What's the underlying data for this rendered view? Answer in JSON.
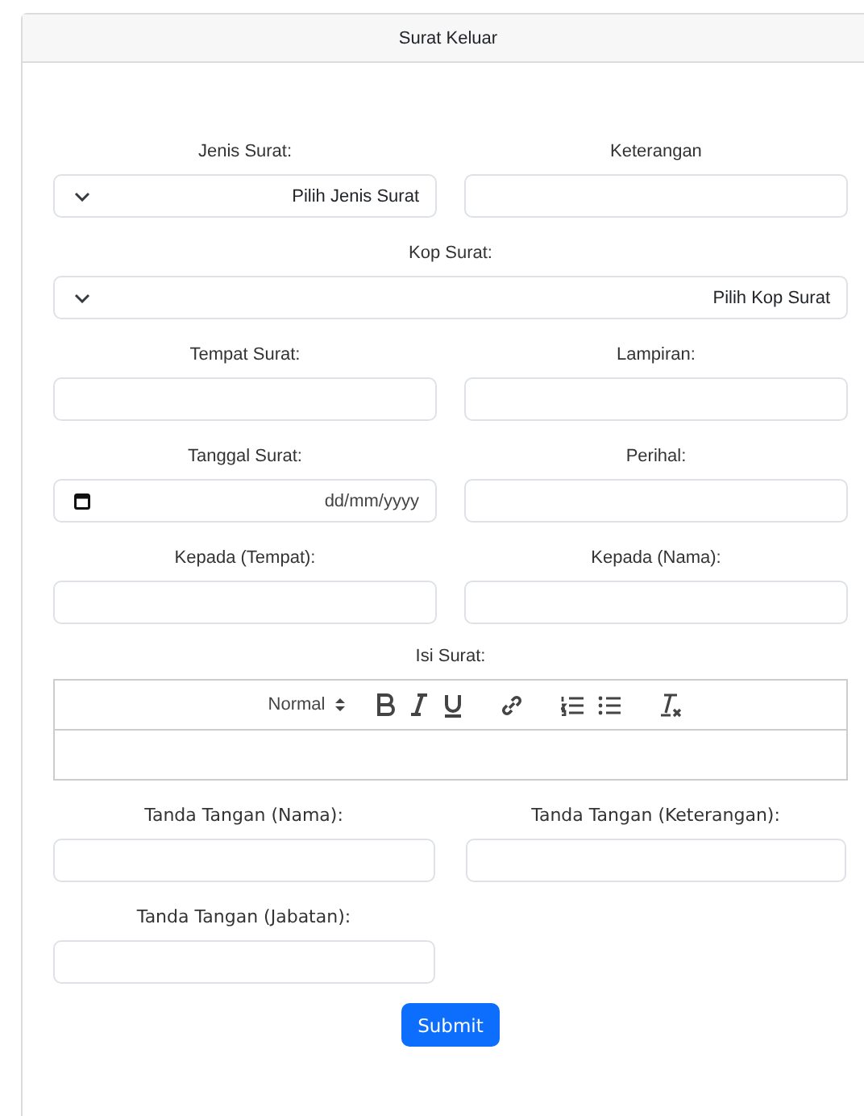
{
  "card": {
    "title": "Surat Keluar"
  },
  "rows": [
    [
      {
        "label": "Jenis Surat:",
        "kind": "select",
        "value": "Pilih Jenis Surat"
      },
      {
        "label": "Keterangan",
        "kind": "text"
      }
    ],
    [
      {
        "label": "Kop Surat:",
        "kind": "select",
        "value": "Pilih Kop Surat"
      }
    ],
    [
      {
        "label": "Tempat Surat:",
        "kind": "text"
      },
      {
        "label": "Lampiran:",
        "kind": "text"
      }
    ],
    [
      {
        "label": "Tanggal Surat:",
        "kind": "date",
        "placeholder": "dd/mm/yyyy"
      },
      {
        "label": "Perihal:",
        "kind": "text"
      }
    ],
    [
      {
        "label": "Kepada (Tempat):",
        "kind": "text"
      },
      {
        "label": "Kepada (Nama):",
        "kind": "text"
      }
    ]
  ],
  "editor": {
    "label": "Isi Surat:",
    "format": "Normal",
    "tools": [
      {
        "kind": "bold"
      },
      {
        "kind": "italic"
      },
      {
        "kind": "underline"
      },
      {
        "kind": "link"
      },
      {
        "kind": "ordered-list"
      },
      {
        "kind": "bullet-list"
      },
      {
        "kind": "clean"
      }
    ]
  },
  "signature_rows": [
    [
      {
        "label": "Tanda Tangan (Nama):"
      },
      {
        "label": "Tanda Tangan (Keterangan):"
      }
    ],
    [
      {
        "label": "Tanda Tangan (Jabatan):"
      }
    ]
  ],
  "submit": "Submit"
}
